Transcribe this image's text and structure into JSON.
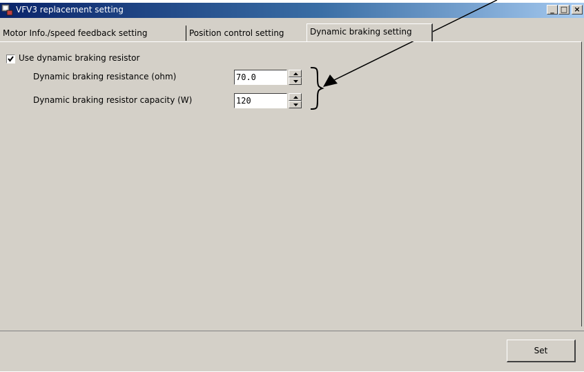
{
  "window": {
    "title": "VFV3 replacement setting",
    "controls": {
      "minimize": "_",
      "maximize": "□",
      "close": "×"
    }
  },
  "tabs": [
    {
      "label": "Motor Info./speed feedback setting",
      "active": false
    },
    {
      "label": "Position control setting",
      "active": false
    },
    {
      "label": "Dynamic braking setting",
      "active": true
    }
  ],
  "panel": {
    "use_resistor_label": "Use dynamic braking resistor",
    "use_resistor_checked": true,
    "fields": [
      {
        "label": "Dynamic braking resistance (ohm)",
        "value": "70.0"
      },
      {
        "label": "Dynamic braking resistor capacity (W)",
        "value": "120"
      }
    ]
  },
  "footer": {
    "set_label": "Set"
  },
  "colors": {
    "titlebar_start": "#0a246a",
    "titlebar_end": "#a6caf0",
    "face": "#d4d0c8"
  }
}
